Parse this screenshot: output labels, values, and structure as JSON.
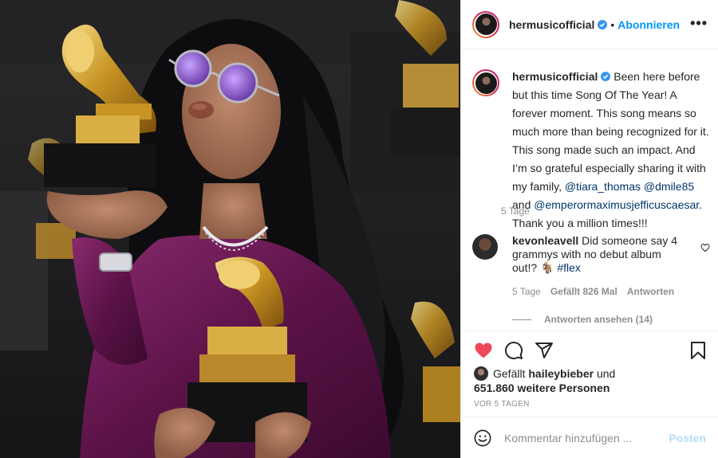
{
  "header": {
    "username": "hermusicofficial",
    "separator": "•",
    "follow_label": "Abonnieren",
    "more_label": "•••"
  },
  "caption": {
    "username": "hermusicofficial",
    "text_1": " Been here before but this time Song Of The Year! A forever moment. This song means so much more than being recognized for it. This song made such an impact. And I’m so grateful especially sharing it with my family, ",
    "mention_1": "@tiara_thomas",
    "mention_2": "@dmile85",
    "text_and": " and ",
    "mention_3": "@emperormaximusjefficuscaesar",
    "text_2": ". Thank you a million times!!!",
    "time": "5 Tage"
  },
  "comment": {
    "username": "kevonleavell",
    "text": " Did someone say 4 grammys with no debut album out!? 🐐 ",
    "hashtag": "#flex",
    "time": "5 Tage",
    "likes": "Gefällt 826 Mal",
    "reply_label": "Antworten"
  },
  "replies_label": "Antworten ansehen (14)",
  "likes": {
    "prefix": "Gefällt ",
    "user": "haileybieber",
    "middle": " und",
    "count": "651.860 weitere Personen"
  },
  "date": "VOR 5 TAGEN",
  "add_comment": {
    "placeholder": "Kommentar hinzufügen ...",
    "post_label": "Posten"
  },
  "icons": {
    "heart": "heart-filled-icon",
    "comment": "comment-icon",
    "share": "share-icon",
    "save": "bookmark-icon",
    "emoji": "emoji-icon",
    "verified": "verified-icon"
  },
  "colors": {
    "accent": "#0095f6",
    "like_red": "#ed4956",
    "mention": "#00376b",
    "muted": "#8e8e8e",
    "post_disabled": "#b2dffc"
  }
}
